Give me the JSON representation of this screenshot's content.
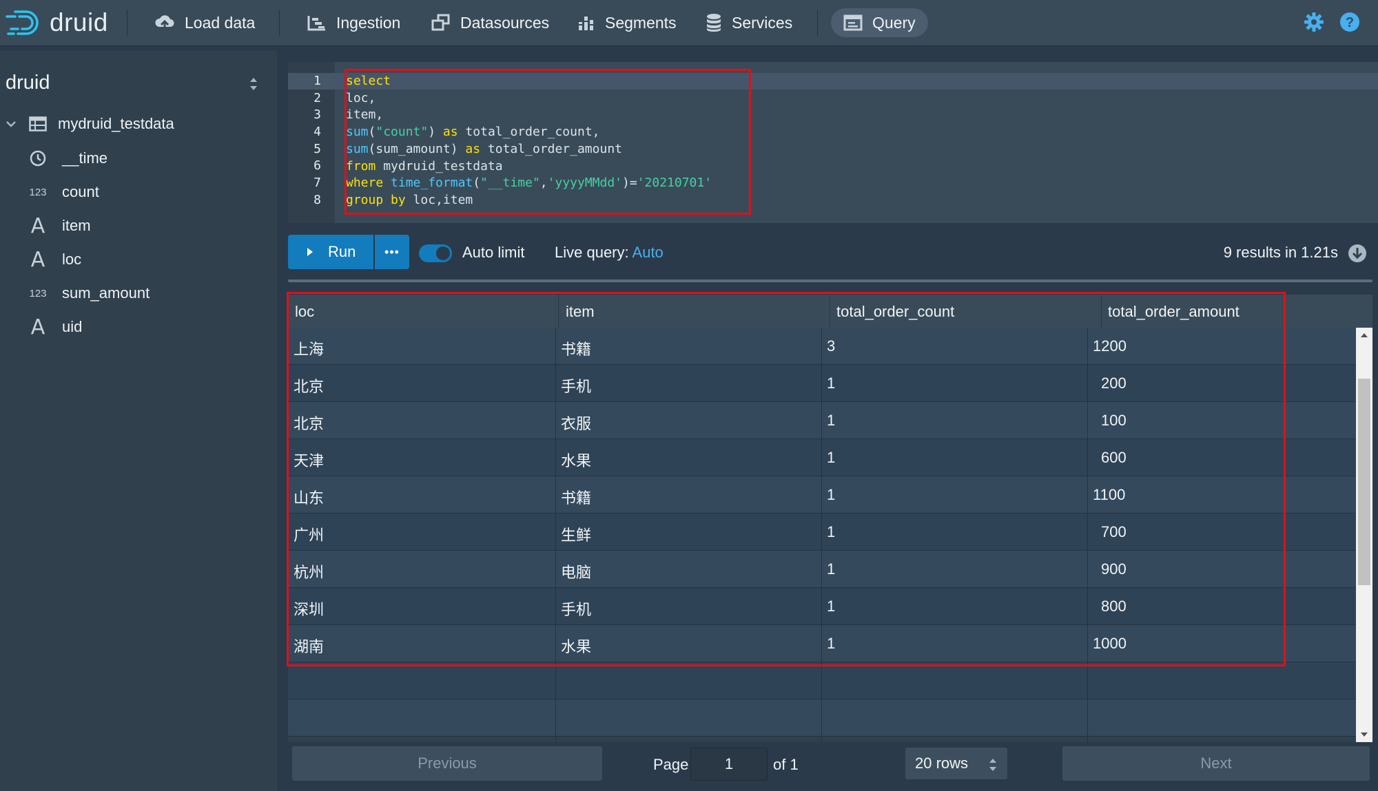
{
  "app": {
    "logo_text": "druid"
  },
  "nav": {
    "items": [
      {
        "label": "Load data",
        "icon": "cloud-upload-icon"
      },
      {
        "label": "Ingestion",
        "icon": "gantt-chart-icon"
      },
      {
        "label": "Datasources",
        "icon": "multi-select-icon"
      },
      {
        "label": "Segments",
        "icon": "stacked-chart-icon"
      },
      {
        "label": "Services",
        "icon": "database-icon"
      },
      {
        "label": "Query",
        "icon": "application-icon",
        "active": true
      }
    ],
    "right_icons": [
      "settings-icon",
      "help-icon"
    ]
  },
  "sidebar": {
    "database": "druid",
    "datasource": "mydruid_testdata",
    "columns": [
      {
        "name": "__time",
        "type_icon": "clock-icon"
      },
      {
        "name": "count",
        "type_icon": "123"
      },
      {
        "name": "item",
        "type_icon": "A"
      },
      {
        "name": "loc",
        "type_icon": "A"
      },
      {
        "name": "sum_amount",
        "type_icon": "123"
      },
      {
        "name": "uid",
        "type_icon": "A"
      }
    ]
  },
  "editor": {
    "line_numbers": [
      "1",
      "2",
      "3",
      "4",
      "5",
      "6",
      "7",
      "8"
    ],
    "lines": [
      "select",
      "loc,",
      "item,",
      "sum(\"count\") as total_order_count,",
      "sum(sum_amount) as total_order_amount",
      "from mydruid_testdata",
      "where time_format(\"__time\",'yyyyMMdd')='20210701'",
      "group by loc,item"
    ]
  },
  "toolbar": {
    "run_label": "Run",
    "more_label": "•••",
    "auto_limit_label": "Auto limit",
    "live_query_label": "Live query:",
    "live_query_value": "Auto",
    "results_info": "9 results in 1.21s"
  },
  "table": {
    "columns": [
      "loc",
      "item",
      "total_order_count",
      "total_order_amount"
    ],
    "rows": [
      [
        "上海",
        "书籍",
        "3",
        "1200"
      ],
      [
        "北京",
        "手机",
        "1",
        "200"
      ],
      [
        "北京",
        "衣服",
        "1",
        "100"
      ],
      [
        "天津",
        "水果",
        "1",
        "600"
      ],
      [
        "山东",
        "书籍",
        "1",
        "1100"
      ],
      [
        "广州",
        "生鲜",
        "1",
        "700"
      ],
      [
        "杭州",
        "电脑",
        "1",
        "900"
      ],
      [
        "深圳",
        "手机",
        "1",
        "800"
      ],
      [
        "湖南",
        "水果",
        "1",
        "1000"
      ]
    ]
  },
  "pagination": {
    "previous_label": "Previous",
    "page_label": "Page",
    "page_value": "1",
    "of_label": "of 1",
    "rows_label": "20 rows",
    "next_label": "Next"
  }
}
